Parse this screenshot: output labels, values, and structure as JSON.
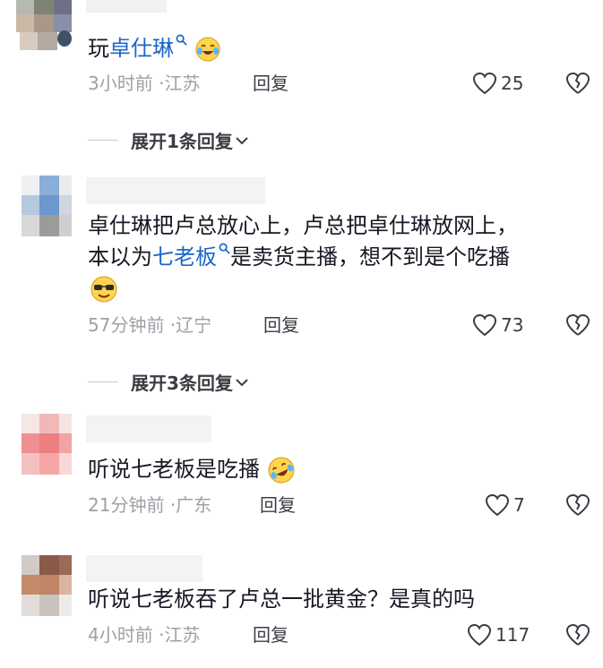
{
  "comments": [
    {
      "text_plain": "玩",
      "text_link": "卓仕琳",
      "text_after": "",
      "emoji": "tears-of-joy-face",
      "time": "3小时前",
      "location": "江苏",
      "reply_label": "回复",
      "likes": "25",
      "expand_label": "展开1条回复"
    },
    {
      "line1": "卓仕琳把卢总放心上，卢总把卓仕琳放网上，",
      "line2_before": "本以为",
      "line2_link": "七老板",
      "line2_after": "是卖货主播，想不到是个吃播",
      "emoji": "cool-face",
      "time": "57分钟前",
      "location": "辽宁",
      "reply_label": "回复",
      "likes": "73",
      "expand_label": "展开3条回复"
    },
    {
      "text": "听说七老板是吃播",
      "emoji": "rolling-laughing-face",
      "time": "21分钟前",
      "location": "广东",
      "reply_label": "回复",
      "likes": "7"
    },
    {
      "text": "听说七老板吞了卢总一批黄金？是真的吗",
      "time": "4小时前",
      "location": "江苏",
      "reply_label": "回复",
      "likes": "117"
    }
  ],
  "separator": "·",
  "colors": {
    "link": "#1b66c9",
    "meta": "#9ea0a6",
    "text": "#161823"
  },
  "icons": [
    "search-icon",
    "heart-icon",
    "broken-heart-icon",
    "chevron-down-icon"
  ]
}
